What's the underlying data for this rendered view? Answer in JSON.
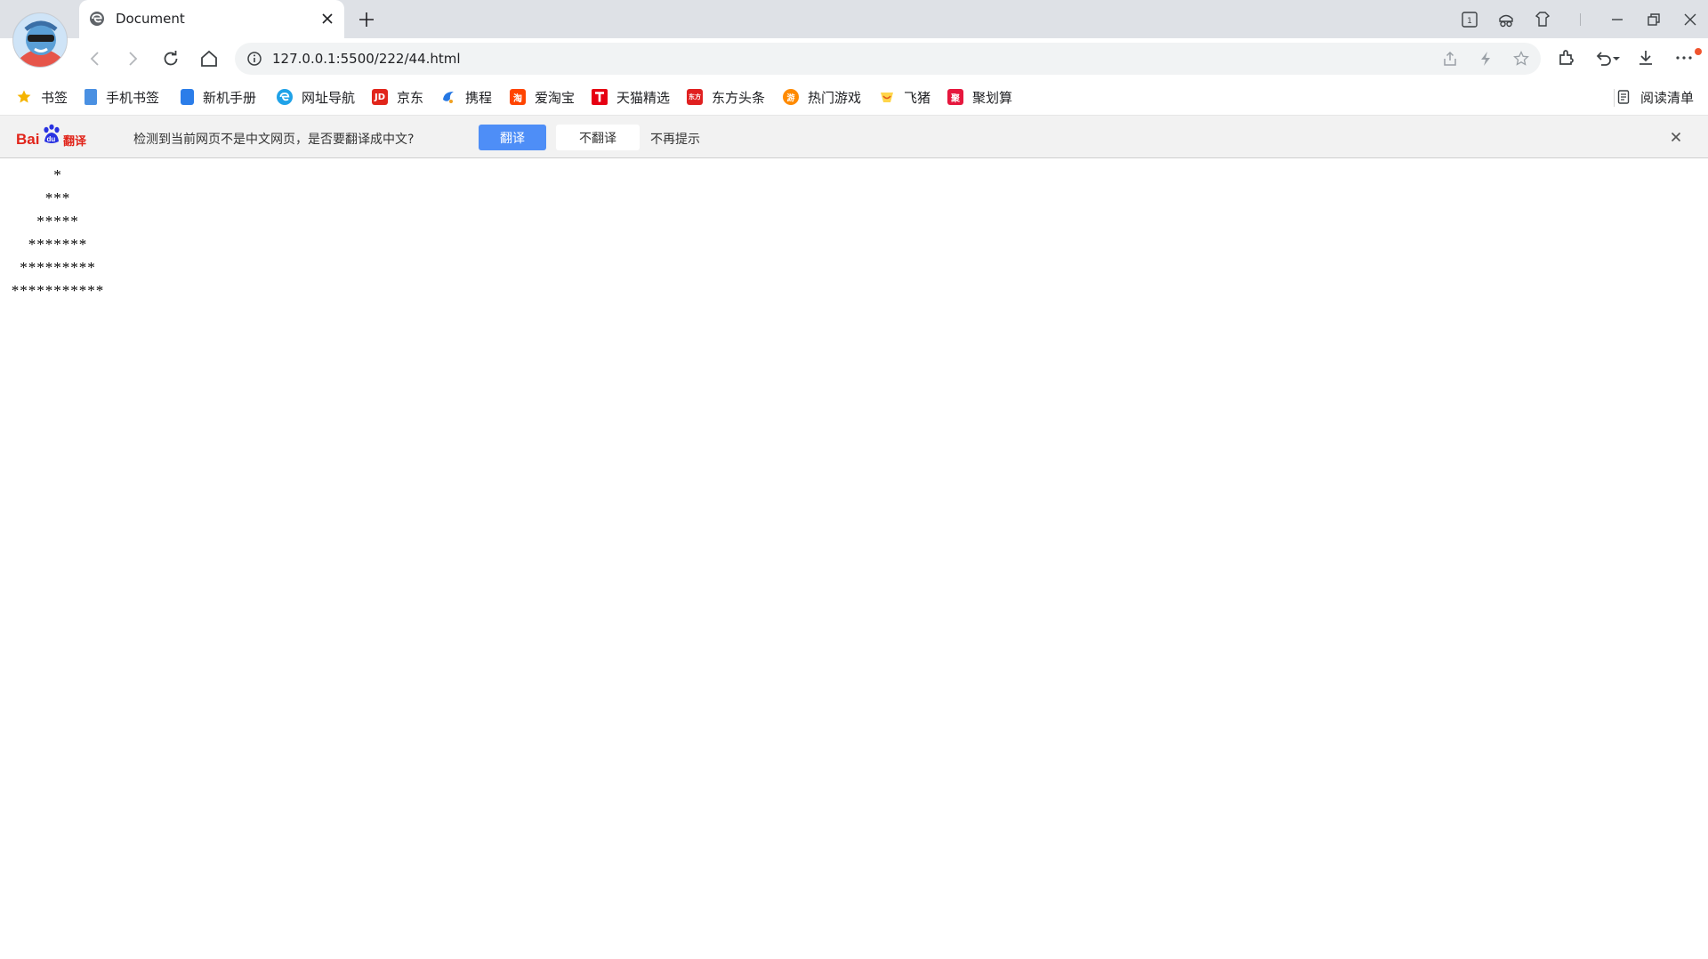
{
  "browser": {
    "tab": {
      "title": "Document",
      "favicon": "edge-e-icon"
    },
    "new_tab_label": "+",
    "window_controls": [
      "tab-count-icon",
      "sidebar-icon",
      "extensions-pin-icon",
      "minimize-icon",
      "restore-icon",
      "close-icon"
    ],
    "tab_count": "1"
  },
  "toolbar": {
    "url": "127.0.0.1:5500/222/44.html",
    "icons": [
      "back-icon",
      "forward-icon",
      "reload-icon",
      "home-icon",
      "site-info-icon",
      "share-icon",
      "lightning-icon",
      "favorite-star-icon",
      "extensions-icon",
      "undo-icon",
      "download-icon",
      "more-icon"
    ]
  },
  "bookmarks": {
    "items": [
      {
        "label": "书签",
        "color": "#f5b400"
      },
      {
        "label": "手机书签",
        "color": "#4a90e2"
      },
      {
        "label": "新机手册",
        "color": "#2b7de9"
      },
      {
        "label": "网址导航",
        "color": "#1fa2e8"
      },
      {
        "label": "京东",
        "color": "#e1251b",
        "glyph": "JD"
      },
      {
        "label": "携程",
        "color": "#2577e3"
      },
      {
        "label": "爱淘宝",
        "color": "#ff4400",
        "glyph": "淘"
      },
      {
        "label": "天猫精选",
        "color": "#e60012",
        "glyph": "T"
      },
      {
        "label": "东方头条",
        "color": "#e02020",
        "glyph": "东方"
      },
      {
        "label": "热门游戏",
        "color": "#ff8a00",
        "glyph": "游"
      },
      {
        "label": "飞猪",
        "color": "#ffb400"
      },
      {
        "label": "聚划算",
        "color": "#e6173d",
        "glyph": "聚"
      }
    ],
    "reading_list": "阅读清单"
  },
  "translate_bar": {
    "logo": {
      "bai": "Bai",
      "du": "du",
      "fanyi": "翻译"
    },
    "message": "检测到当前网页不是中文网页，是否要翻译成中文?",
    "translate": "翻译",
    "no_translate": "不翻译",
    "never": "不再提示"
  },
  "content": {
    "rows": [
      "*",
      "***",
      "*****",
      "*******",
      "*********",
      "***********"
    ]
  },
  "colors": {
    "accent": "#4e8ef7",
    "tabstrip": "#dee1e6",
    "notification": "#f0542d"
  }
}
